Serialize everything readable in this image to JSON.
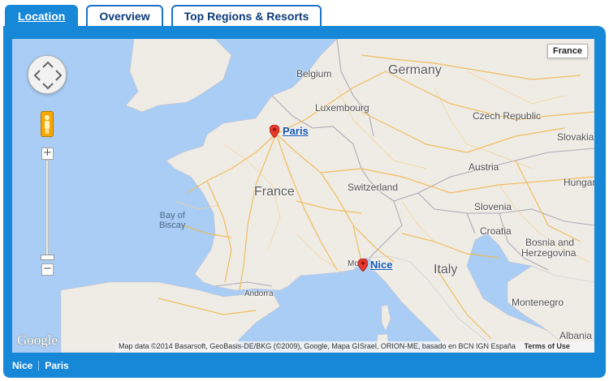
{
  "tabs": [
    {
      "label": "Location",
      "active": true
    },
    {
      "label": "Overview",
      "active": false
    },
    {
      "label": "Top Regions & Resorts",
      "active": false
    }
  ],
  "map": {
    "map_type_label": "France",
    "google_logo": "Google",
    "attribution": "Map data ©2014 Basarsoft, GeoBasis-DE/BKG (©2009), Google, Mapa GISrael, ORION-ME, basado en BCN IGN España",
    "terms": "Terms of Use",
    "countries": {
      "france": "France",
      "germany": "Germany",
      "italy": "Italy",
      "belgium": "Belgium",
      "luxembourg": "Luxembourg",
      "switzerland": "Switzerland",
      "austria": "Austria",
      "czech": "Czech Republic",
      "slovakia": "Slovakia",
      "hungary": "Hungar",
      "slovenia": "Slovenia",
      "croatia": "Croatia",
      "bosnia": "Bosnia and",
      "bosnia2": "Herzegovina",
      "montenegro": "Montenegro",
      "albania": "Albania",
      "andorra": "Andorra",
      "monaco_stub": "Mo"
    },
    "seas": {
      "biscay": "Bay of",
      "biscay2": "Biscay"
    },
    "markers": [
      {
        "label": "Paris"
      },
      {
        "label": "Nice"
      }
    ],
    "colors": {
      "water": "#a9cdf5",
      "land": "#efece6",
      "roads": "#f2b950",
      "borders": "#b0a9b5",
      "marker": "#e8382c"
    }
  },
  "footer": {
    "links": [
      "Nice",
      "Paris"
    ]
  },
  "theme": {
    "accent": "#1787d8",
    "tab_text": "#0b3a7a"
  }
}
